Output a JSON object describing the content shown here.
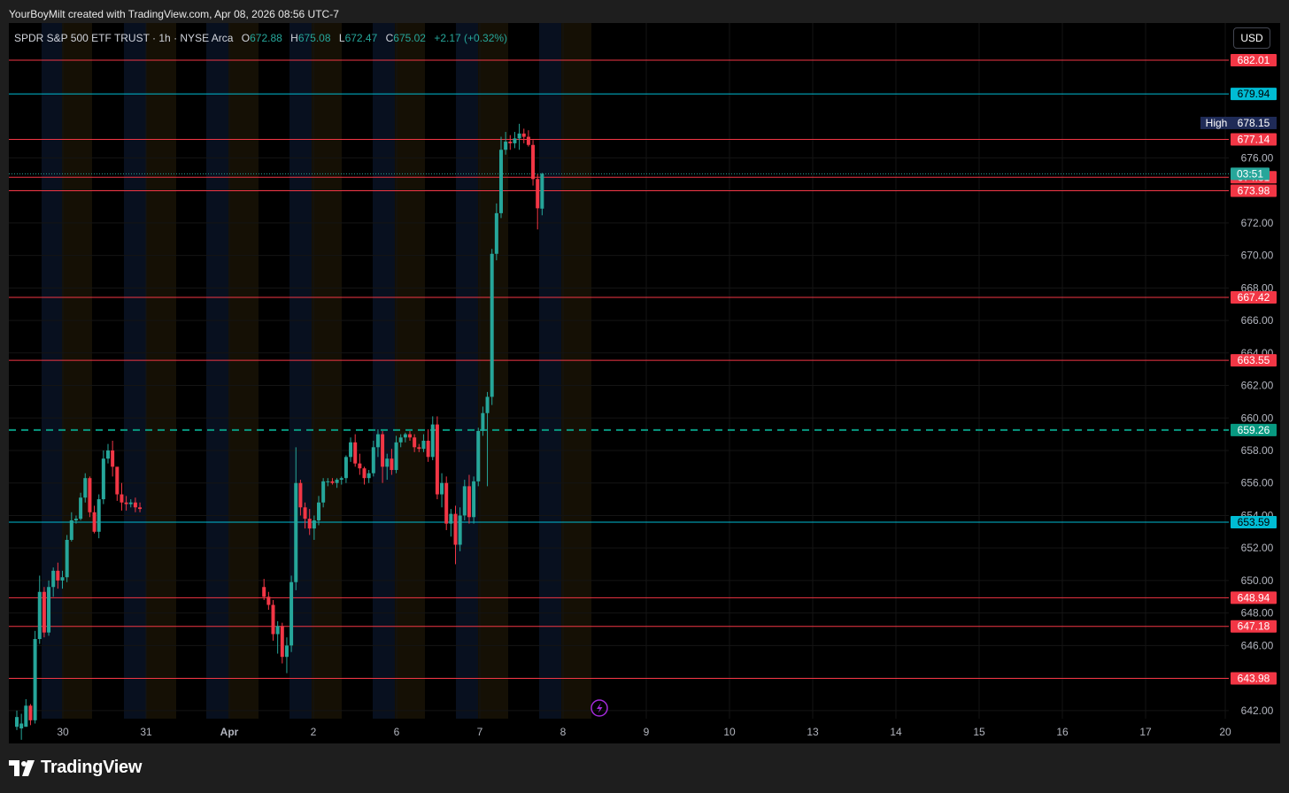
{
  "attribution": "YourBoyMilt created with TradingView.com, Apr 08, 2026 08:56 UTC-7",
  "brand": "TradingView",
  "currency_button": "USD",
  "legend": {
    "symbol": "SPDR S&P 500 ETF TRUST · 1h · NYSE Arca",
    "open_label": "O",
    "open": "672.88",
    "high_label": "H",
    "high": "675.08",
    "low_label": "L",
    "low": "672.47",
    "close_label": "C",
    "close": "675.02",
    "change": "+2.17 (+0.32%)"
  },
  "chart_data": {
    "type": "candlestick",
    "interval": "1h",
    "y_range": [
      641.5,
      684.3
    ],
    "y_ticks": [
      642,
      644,
      646,
      648,
      650,
      652,
      654,
      656,
      658,
      660,
      662,
      664,
      666,
      668,
      670,
      672,
      674,
      676
    ],
    "x_labels": [
      "30",
      "31",
      "Apr",
      "2",
      "6",
      "7",
      "8",
      "9",
      "10",
      "13",
      "14",
      "15",
      "16",
      "17",
      "20"
    ],
    "colors": {
      "up": "#26a69a",
      "down": "#f23645",
      "red_level": "#f23645",
      "cyan_level": "#00bcd4",
      "dashed_level": "#089981"
    },
    "horizontal_levels": [
      {
        "value": 682.01,
        "label": "682.01",
        "color": "red"
      },
      {
        "value": 679.94,
        "label": "679.94",
        "color": "cyan"
      },
      {
        "value": 677.14,
        "label": "677.14",
        "color": "red"
      },
      {
        "value": 674.81,
        "label": "674.81",
        "color": "red"
      },
      {
        "value": 673.98,
        "label": "673.98",
        "color": "red"
      },
      {
        "value": 667.42,
        "label": "667.42",
        "color": "red"
      },
      {
        "value": 663.55,
        "label": "663.55",
        "color": "red"
      },
      {
        "value": 659.26,
        "label": "659.26",
        "color": "teal",
        "style": "dashed"
      },
      {
        "value": 653.59,
        "label": "653.59",
        "color": "cyan"
      },
      {
        "value": 648.94,
        "label": "648.94",
        "color": "red"
      },
      {
        "value": 647.18,
        "label": "647.18",
        "color": "red"
      },
      {
        "value": 643.98,
        "label": "643.98",
        "color": "red"
      }
    ],
    "high_marker": {
      "label": "High",
      "value": "678.15"
    },
    "current_price": {
      "value": 675.02,
      "countdown": "03:51"
    },
    "candles": [
      [
        641.0,
        642.0,
        640.8,
        641.6
      ],
      [
        640.9,
        641.8,
        640.2,
        641.2
      ],
      [
        641.0,
        642.7,
        641.0,
        642.3
      ],
      [
        642.3,
        642.4,
        641.1,
        641.4
      ],
      [
        641.4,
        646.9,
        641.2,
        646.4
      ],
      [
        646.4,
        650.3,
        646.1,
        649.3
      ],
      [
        649.3,
        649.6,
        646.5,
        646.8
      ],
      [
        646.8,
        650.0,
        646.6,
        649.6
      ],
      [
        649.6,
        650.8,
        649.0,
        650.6
      ],
      [
        650.6,
        651.1,
        649.5,
        650.0
      ],
      [
        650.0,
        650.6,
        649.5,
        650.2
      ],
      [
        650.2,
        652.8,
        649.9,
        652.5
      ],
      [
        652.5,
        654.2,
        652.4,
        653.7
      ],
      [
        653.7,
        654.0,
        653.5,
        653.8
      ],
      [
        653.8,
        655.4,
        653.7,
        655.1
      ],
      [
        655.1,
        656.6,
        654.8,
        656.3
      ],
      [
        656.3,
        656.4,
        653.9,
        654.2
      ],
      [
        654.2,
        654.6,
        652.9,
        653.0
      ],
      [
        653.0,
        655.3,
        652.6,
        655.0
      ],
      [
        655.0,
        658.0,
        654.7,
        657.5
      ],
      [
        657.5,
        658.4,
        657.2,
        658.0
      ],
      [
        658.0,
        658.6,
        656.4,
        657.0
      ],
      [
        657.0,
        656.7,
        654.9,
        655.3
      ],
      [
        655.3,
        656.0,
        654.3,
        654.8
      ],
      [
        654.8,
        655.2,
        654.3,
        654.7
      ],
      [
        654.7,
        655.0,
        654.5,
        654.8
      ],
      [
        654.8,
        655.1,
        654.2,
        654.5
      ],
      [
        654.5,
        654.8,
        654.2,
        654.4
      ],
      [
        649.6,
        650.1,
        648.8,
        649.0
      ],
      [
        649.0,
        649.3,
        648.2,
        648.5
      ],
      [
        648.5,
        648.8,
        646.3,
        646.7
      ],
      [
        646.7,
        647.5,
        645.5,
        647.2
      ],
      [
        647.2,
        647.4,
        644.9,
        645.3
      ],
      [
        645.3,
        646.5,
        644.3,
        646.0
      ],
      [
        646.0,
        650.3,
        645.6,
        649.9
      ],
      [
        649.9,
        658.2,
        649.4,
        656.0
      ],
      [
        656.0,
        656.2,
        654.0,
        654.5
      ],
      [
        654.5,
        654.8,
        653.2,
        653.8
      ],
      [
        653.8,
        654.4,
        652.8,
        653.2
      ],
      [
        653.2,
        654.0,
        652.5,
        653.7
      ],
      [
        653.7,
        655.2,
        653.4,
        654.8
      ],
      [
        654.8,
        656.3,
        654.5,
        656.1
      ],
      [
        656.1,
        656.3,
        655.8,
        656.1
      ],
      [
        656.1,
        656.3,
        655.9,
        656.0
      ],
      [
        656.0,
        656.3,
        655.7,
        656.2
      ],
      [
        656.2,
        656.4,
        655.9,
        656.3
      ],
      [
        656.3,
        657.7,
        656.0,
        657.6
      ],
      [
        657.6,
        658.8,
        657.3,
        658.5
      ],
      [
        658.5,
        659.0,
        657.0,
        657.2
      ],
      [
        657.2,
        657.8,
        656.5,
        656.9
      ],
      [
        656.9,
        657.0,
        655.9,
        656.3
      ],
      [
        656.3,
        656.8,
        656.0,
        656.6
      ],
      [
        656.6,
        658.6,
        656.4,
        658.2
      ],
      [
        658.2,
        659.3,
        657.6,
        659.0
      ],
      [
        659.0,
        659.2,
        656.0,
        657.0
      ],
      [
        657.0,
        657.8,
        656.2,
        657.5
      ],
      [
        657.5,
        658.1,
        656.5,
        656.8
      ],
      [
        656.8,
        658.9,
        656.6,
        658.5
      ],
      [
        658.5,
        659.0,
        658.2,
        658.8
      ],
      [
        658.8,
        659.1,
        658.5,
        659.0
      ],
      [
        659.0,
        659.2,
        658.6,
        658.8
      ],
      [
        658.8,
        659.0,
        657.9,
        658.2
      ],
      [
        658.2,
        658.4,
        657.9,
        658.1
      ],
      [
        658.1,
        659.0,
        657.9,
        658.6
      ],
      [
        658.6,
        659.3,
        657.3,
        657.6
      ],
      [
        657.6,
        660.1,
        657.4,
        659.6
      ],
      [
        659.6,
        660.1,
        655.0,
        655.3
      ],
      [
        655.3,
        656.6,
        654.5,
        656.0
      ],
      [
        656.0,
        656.4,
        653.1,
        653.5
      ],
      [
        653.5,
        654.4,
        652.7,
        654.1
      ],
      [
        654.1,
        654.6,
        651.0,
        652.2
      ],
      [
        652.2,
        654.5,
        651.8,
        654.0
      ],
      [
        654.0,
        656.2,
        653.7,
        655.8
      ],
      [
        655.8,
        656.5,
        653.5,
        653.9
      ],
      [
        653.9,
        656.4,
        653.5,
        656.1
      ],
      [
        656.1,
        659.4,
        655.8,
        659.2
      ],
      [
        659.2,
        660.7,
        658.9,
        660.3
      ],
      [
        660.3,
        661.6,
        655.8,
        661.3
      ],
      [
        661.3,
        670.4,
        660.8,
        670.1
      ],
      [
        670.1,
        673.2,
        669.7,
        672.6
      ],
      [
        672.6,
        677.3,
        672.3,
        676.5
      ],
      [
        676.5,
        677.6,
        676.2,
        677.0
      ],
      [
        677.0,
        677.4,
        676.5,
        676.9
      ],
      [
        676.9,
        677.6,
        676.6,
        677.2
      ],
      [
        677.2,
        678.1,
        676.5,
        677.5
      ],
      [
        677.5,
        677.8,
        676.9,
        677.3
      ],
      [
        677.3,
        677.7,
        676.7,
        676.8
      ],
      [
        676.8,
        677.1,
        674.3,
        674.7
      ],
      [
        674.7,
        675.0,
        671.6,
        672.9
      ],
      [
        672.88,
        675.08,
        672.47,
        675.02
      ]
    ]
  }
}
